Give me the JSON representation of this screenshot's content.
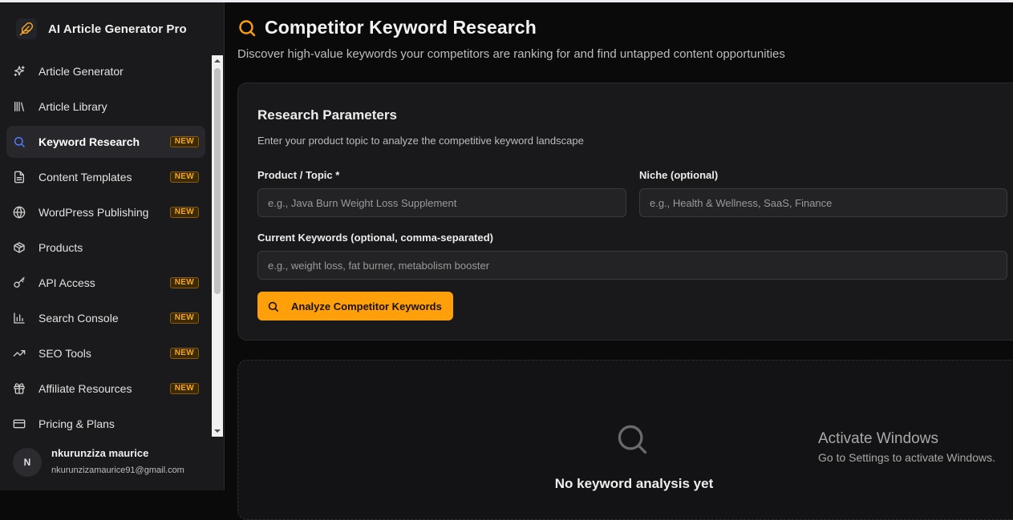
{
  "app": {
    "title": "AI Article Generator Pro"
  },
  "sidebar": {
    "items": [
      {
        "label": "Article Generator",
        "icon": "sparkles-icon",
        "badge": "",
        "active": false
      },
      {
        "label": "Article Library",
        "icon": "library-icon",
        "badge": "",
        "active": false
      },
      {
        "label": "Keyword Research",
        "icon": "search-icon",
        "badge": "NEW",
        "active": true
      },
      {
        "label": "Content Templates",
        "icon": "file-text-icon",
        "badge": "NEW",
        "active": false
      },
      {
        "label": "WordPress Publishing",
        "icon": "globe-icon",
        "badge": "NEW",
        "active": false
      },
      {
        "label": "Products",
        "icon": "package-icon",
        "badge": "",
        "active": false
      },
      {
        "label": "API Access",
        "icon": "key-icon",
        "badge": "NEW",
        "active": false
      },
      {
        "label": "Search Console",
        "icon": "bar-chart-icon",
        "badge": "NEW",
        "active": false
      },
      {
        "label": "SEO Tools",
        "icon": "trending-up-icon",
        "badge": "NEW",
        "active": false
      },
      {
        "label": "Affiliate Resources",
        "icon": "gift-icon",
        "badge": "NEW",
        "active": false
      },
      {
        "label": "Pricing & Plans",
        "icon": "credit-card-icon",
        "badge": "",
        "active": false
      }
    ]
  },
  "user": {
    "initial": "N",
    "name": "nkurunziza maurice",
    "email": "nkurunzizamaurice91@gmail.com"
  },
  "page": {
    "title": "Competitor Keyword Research",
    "subtitle": "Discover high-value keywords your competitors are ranking for and find untapped content opportunities"
  },
  "form": {
    "title": "Research Parameters",
    "description": "Enter your product topic to analyze the competitive keyword landscape",
    "product_label": "Product / Topic *",
    "product_placeholder": "e.g., Java Burn Weight Loss Supplement",
    "product_value": "",
    "niche_label": "Niche (optional)",
    "niche_placeholder": "e.g., Health & Wellness, SaaS, Finance",
    "niche_value": "",
    "keywords_label": "Current Keywords (optional, comma-separated)",
    "keywords_placeholder": "e.g., weight loss, fat burner, metabolism booster",
    "keywords_value": "",
    "analyze_label": "Analyze Competitor Keywords"
  },
  "empty": {
    "title": "No keyword analysis yet"
  },
  "watermark": {
    "title": "Activate Windows",
    "subtitle": "Go to Settings to activate Windows."
  },
  "colors": {
    "accent": "#ff9f0a",
    "active_icon": "#4d7cfe",
    "badge_text": "#f5a623",
    "sidebar_bg": "#1a1a1c",
    "main_bg": "#0a0a0b"
  }
}
